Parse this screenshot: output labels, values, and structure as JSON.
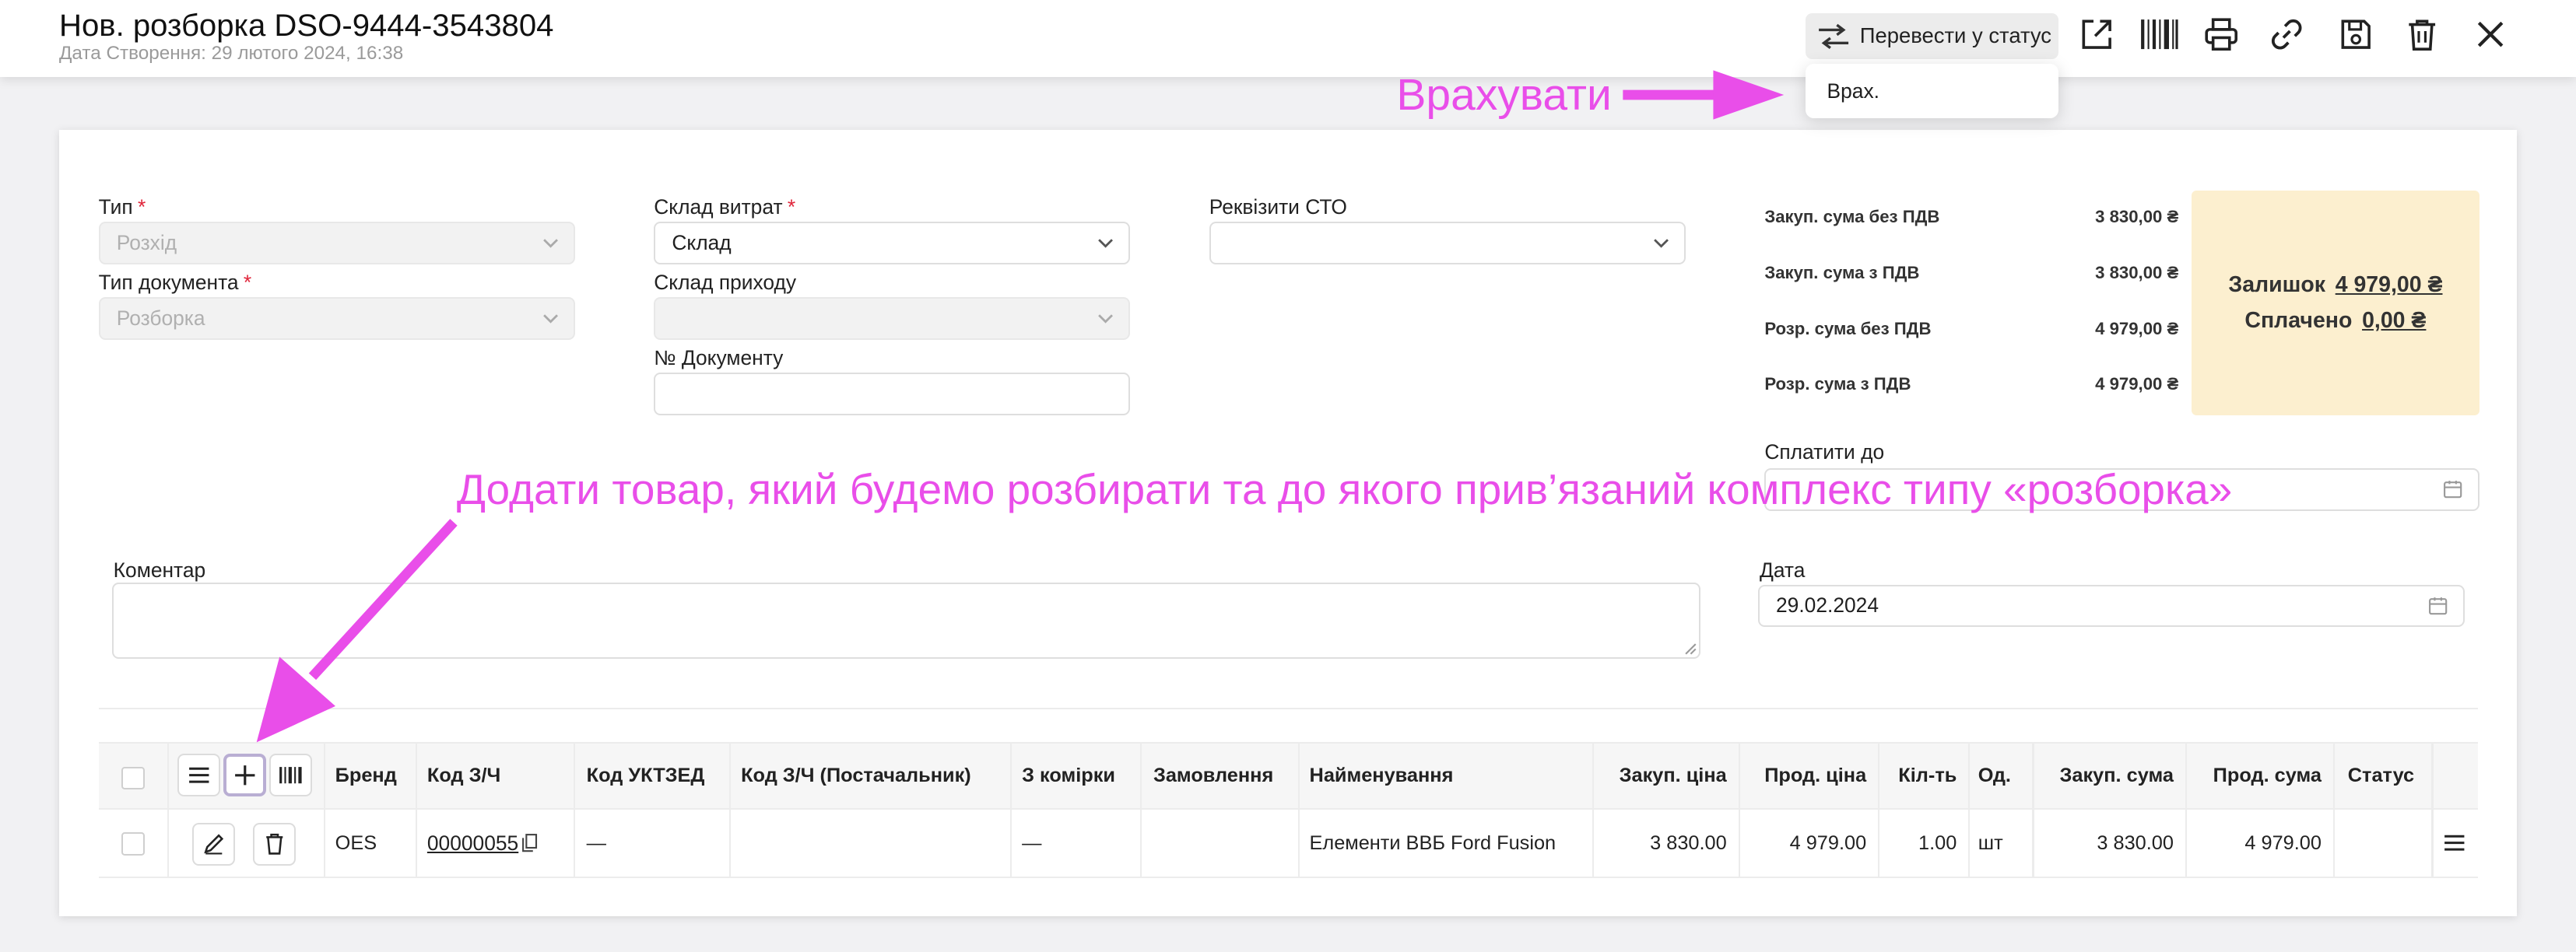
{
  "header": {
    "title": "Нов. розборка DSO-9444-3543804",
    "created": "Дата Створення: 29 лютого 2024, 16:38",
    "status_button": "Перевести у статус",
    "dropdown_item": "Врах."
  },
  "form": {
    "type_label": "Тип",
    "type_value": "Розхід",
    "doc_type_label": "Тип документа",
    "doc_type_value": "Розборка",
    "expense_wh_label": "Склад витрат",
    "expense_wh_value": "Склад",
    "income_wh_label": "Склад приходу",
    "doc_number_label": "№ Документу",
    "sto_label": "Реквізити СТО",
    "pay_until_label": "Сплатити до",
    "comment_label": "Коментар",
    "date_label": "Дата",
    "date_value": "29.02.2024",
    "required_mark": "*"
  },
  "sums": [
    {
      "label": "Закуп. сума без ПДВ",
      "value": "3 830,00 ₴"
    },
    {
      "label": "Закуп. сума з ПДВ",
      "value": "3 830,00 ₴"
    },
    {
      "label": "Розр. сума без ПДВ",
      "value": "4 979,00 ₴"
    },
    {
      "label": "Розр. сума з ПДВ",
      "value": "4 979,00 ₴"
    }
  ],
  "balance": {
    "remaining_label": "Залишок",
    "remaining_value": "4 979,00 ₴",
    "paid_label": "Сплачено",
    "paid_value": "0,00 ₴"
  },
  "table": {
    "columns": [
      "Бренд",
      "Код З/Ч",
      "Код УКТЗЕД",
      "Код З/Ч (Постачальник)",
      "З комірки",
      "Замовлення",
      "Найменування",
      "Закуп. ціна",
      "Прод. ціна",
      "Кіл-ть",
      "Од.",
      "Закуп. сума",
      "Прод. сума",
      "Статус"
    ],
    "row": {
      "brand": "OES",
      "code": "00000055",
      "uktzed": "—",
      "supplier_code": "",
      "from_cell": "—",
      "order": "",
      "name": "Елементи ВВБ Ford Fusion",
      "buy_price": "3 830.00",
      "sell_price": "4 979.00",
      "qty": "1.00",
      "unit": "шт",
      "buy_sum": "3 830.00",
      "sell_sum": "4 979.00",
      "status": ""
    }
  },
  "annotations": {
    "top": "Врахувати",
    "middle": "Додати товар, який будемо розбирати та до якого прив’язаний комплекс типу «розборка»"
  },
  "colors": {
    "annotation": "#e94ee9",
    "balance_bg": "#fcefcf",
    "required": "#e0263b"
  }
}
